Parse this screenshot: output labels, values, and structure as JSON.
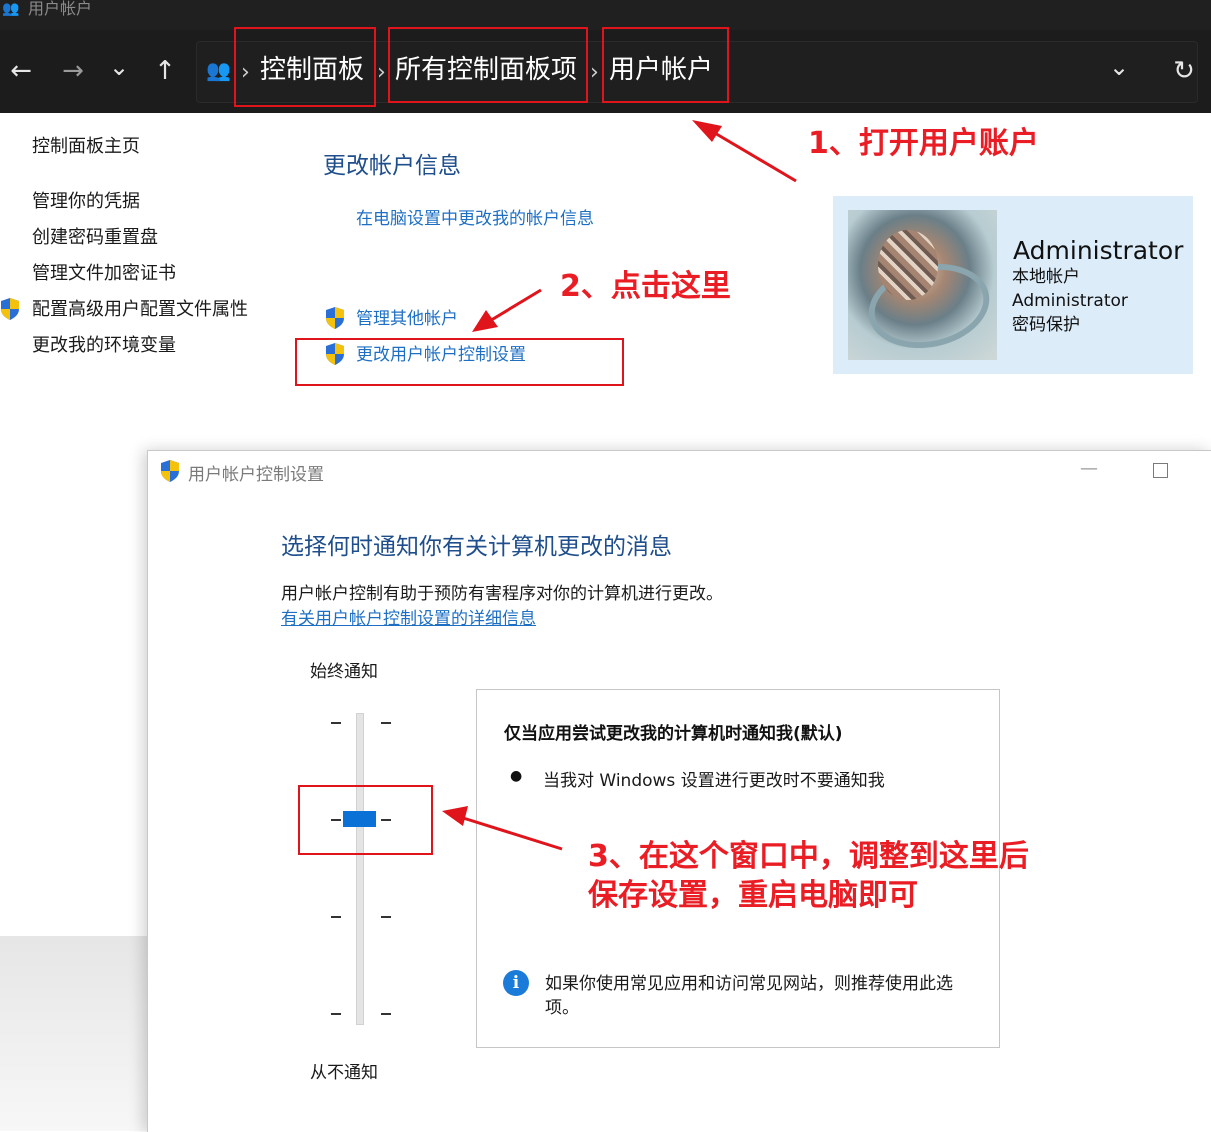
{
  "window": {
    "title": "用户帐户",
    "title_icon": "users-icon"
  },
  "nav": {
    "back": "←",
    "forward": "→",
    "recent": "⌄",
    "up": "↑",
    "dropdown": "⌄",
    "refresh": "↻",
    "breadcrumb_sep": "›",
    "breadcrumbs": [
      "控制面板",
      "所有控制面板项",
      "用户帐户"
    ]
  },
  "sidebar": {
    "items": [
      "控制面板主页",
      "管理你的凭据",
      "创建密码重置盘",
      "管理文件加密证书",
      "配置高级用户配置文件属性",
      "更改我的环境变量"
    ]
  },
  "main": {
    "heading": "更改帐户信息",
    "link_pc_settings": "在电脑设置中更改我的帐户信息",
    "link_manage_others": "管理其他帐户",
    "link_uac_settings": "更改用户帐户控制设置"
  },
  "account": {
    "name": "Administrator",
    "type": "本地帐户",
    "username": "Administrator",
    "password_status": "密码保护"
  },
  "uac_dialog": {
    "title": "用户帐户控制设置",
    "minimize": "—",
    "heading": "选择何时通知你有关计算机更改的消息",
    "description": "用户帐户控制有助于预防有害程序对你的计算机进行更改。",
    "more_info_link": "有关用户帐户控制设置的详细信息",
    "slider_top_label": "始终通知",
    "slider_bottom_label": "从不通知",
    "slider_level": 3,
    "slider_levels": 4,
    "info_title": "仅当应用尝试更改我的计算机时通知我(默认)",
    "info_bullet": "当我对 Windows 设置进行更改时不要通知我",
    "info_note": "如果你使用常见应用和访问常见网站，则推荐使用此选项。",
    "info_icon": "info-icon"
  },
  "annotations": {
    "step1": "1、打开用户账户",
    "step2": "2、点击这里",
    "step3_line1": "3、在这个窗口中，调整到这里后",
    "step3_line2": "保存设置，重启电脑即可",
    "color": "#e0141b"
  }
}
